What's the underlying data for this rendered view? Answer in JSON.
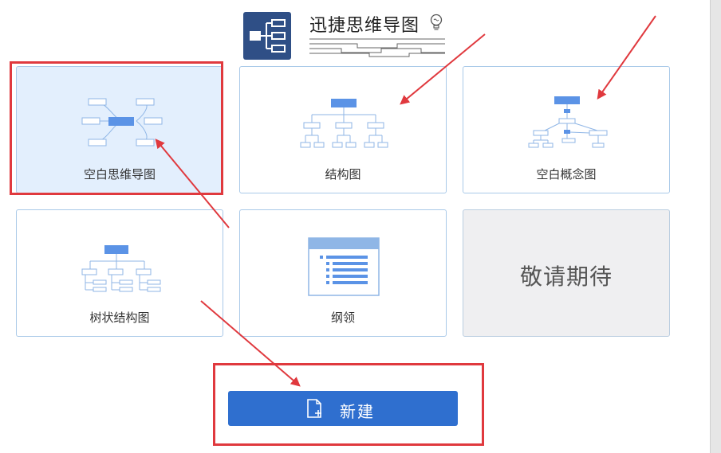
{
  "app": {
    "title": "迅捷思维导图"
  },
  "templates": [
    {
      "label": "空白思维导图",
      "icon": "mindmap-icon",
      "selected": true
    },
    {
      "label": "结构图",
      "icon": "org-chart-icon",
      "selected": false
    },
    {
      "label": "空白概念图",
      "icon": "concept-map-icon",
      "selected": false
    },
    {
      "label": "树状结构图",
      "icon": "tree-chart-icon",
      "selected": false
    },
    {
      "label": "纲领",
      "icon": "outline-icon",
      "selected": false
    }
  ],
  "coming_soon": {
    "label": "敬请期待"
  },
  "actions": {
    "new_label": "新建"
  },
  "colors": {
    "accent": "#2f6fcf",
    "annotation": "#e0393e",
    "card_border": "#a9c9e8",
    "selected_bg": "#e3effd",
    "logo_bg": "#2f4f86"
  }
}
